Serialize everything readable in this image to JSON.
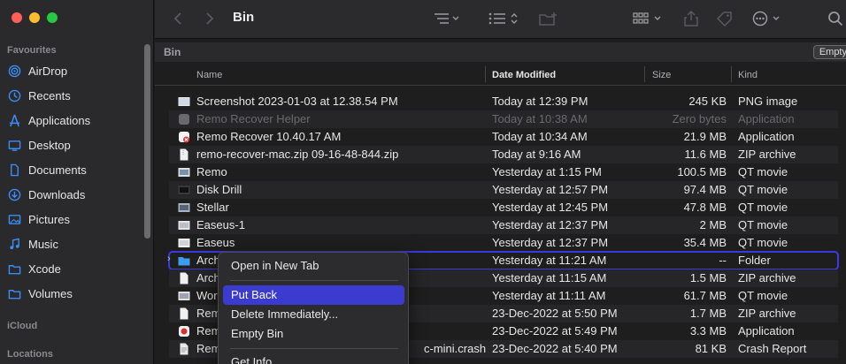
{
  "toolbar": {
    "title": "Bin"
  },
  "pathbar": {
    "label": "Bin",
    "empty_button": "Empty"
  },
  "sidebar": {
    "favourites_label": "Favourites",
    "items": [
      {
        "label": "AirDrop",
        "icon": "airdrop-icon"
      },
      {
        "label": "Recents",
        "icon": "clock-icon"
      },
      {
        "label": "Applications",
        "icon": "applications-icon"
      },
      {
        "label": "Desktop",
        "icon": "desktop-icon"
      },
      {
        "label": "Documents",
        "icon": "document-icon"
      },
      {
        "label": "Downloads",
        "icon": "download-icon"
      },
      {
        "label": "Pictures",
        "icon": "pictures-icon"
      },
      {
        "label": "Music",
        "icon": "music-icon"
      },
      {
        "label": "Xcode",
        "icon": "folder-icon"
      },
      {
        "label": "Volumes",
        "icon": "folder-icon"
      }
    ],
    "icloud_label": "iCloud",
    "locations_label": "Locations"
  },
  "columns": {
    "name": "Name",
    "date": "Date Modified",
    "size": "Size",
    "kind": "Kind"
  },
  "files": [
    {
      "name": "Screenshot 2023-01-03 at 12.38.54 PM",
      "date": "Today at 12:39 PM",
      "size": "245 KB",
      "kind": "PNG image"
    },
    {
      "name": "Remo Recover Helper",
      "date": "Today at 10:38 AM",
      "size": "Zero bytes",
      "kind": "Application"
    },
    {
      "name": "Remo Recover 10.40.17 AM",
      "date": "Today at 10:34 AM",
      "size": "21.9 MB",
      "kind": "Application"
    },
    {
      "name": "remo-recover-mac.zip 09-16-48-844.zip",
      "date": "Today at 9:16 AM",
      "size": "11.6 MB",
      "kind": "ZIP archive"
    },
    {
      "name": "Remo",
      "date": "Yesterday at 1:15 PM",
      "size": "100.5 MB",
      "kind": "QT movie"
    },
    {
      "name": "Disk Drill",
      "date": "Yesterday at 12:57 PM",
      "size": "97.4 MB",
      "kind": "QT movie"
    },
    {
      "name": "Stellar",
      "date": "Yesterday at 12:45 PM",
      "size": "47.8 MB",
      "kind": "QT movie"
    },
    {
      "name": "Easeus-1",
      "date": "Yesterday at 12:37 PM",
      "size": "2 MB",
      "kind": "QT movie"
    },
    {
      "name": "Easeus",
      "date": "Yesterday at 12:37 PM",
      "size": "35.4 MB",
      "kind": "QT movie"
    },
    {
      "name": "Archi",
      "date": "Yesterday at 11:21 AM",
      "size": "--",
      "kind": "Folder"
    },
    {
      "name": "Archi",
      "date": "Yesterday at 11:15 AM",
      "size": "1.5 MB",
      "kind": "ZIP archive"
    },
    {
      "name": "Wor",
      "date": "Yesterday at 11:11 AM",
      "size": "61.7 MB",
      "kind": "QT movie"
    },
    {
      "name": "Rem",
      "date": "23-Dec-2022 at 5:50 PM",
      "size": "1.7 MB",
      "kind": "ZIP archive"
    },
    {
      "name": "Rem",
      "date": "23-Dec-2022 at 5:49 PM",
      "size": "3.3 MB",
      "kind": "Application"
    },
    {
      "name": "Rem",
      "name_tail": "c-mini.crash",
      "date": "23-Dec-2022 at 5:40 PM",
      "size": "81 KB",
      "kind": "Crash Report"
    }
  ],
  "context_menu": {
    "items": [
      "Open in New Tab",
      "Put Back",
      "Delete Immediately...",
      "Empty Bin",
      "Get Info"
    ]
  }
}
